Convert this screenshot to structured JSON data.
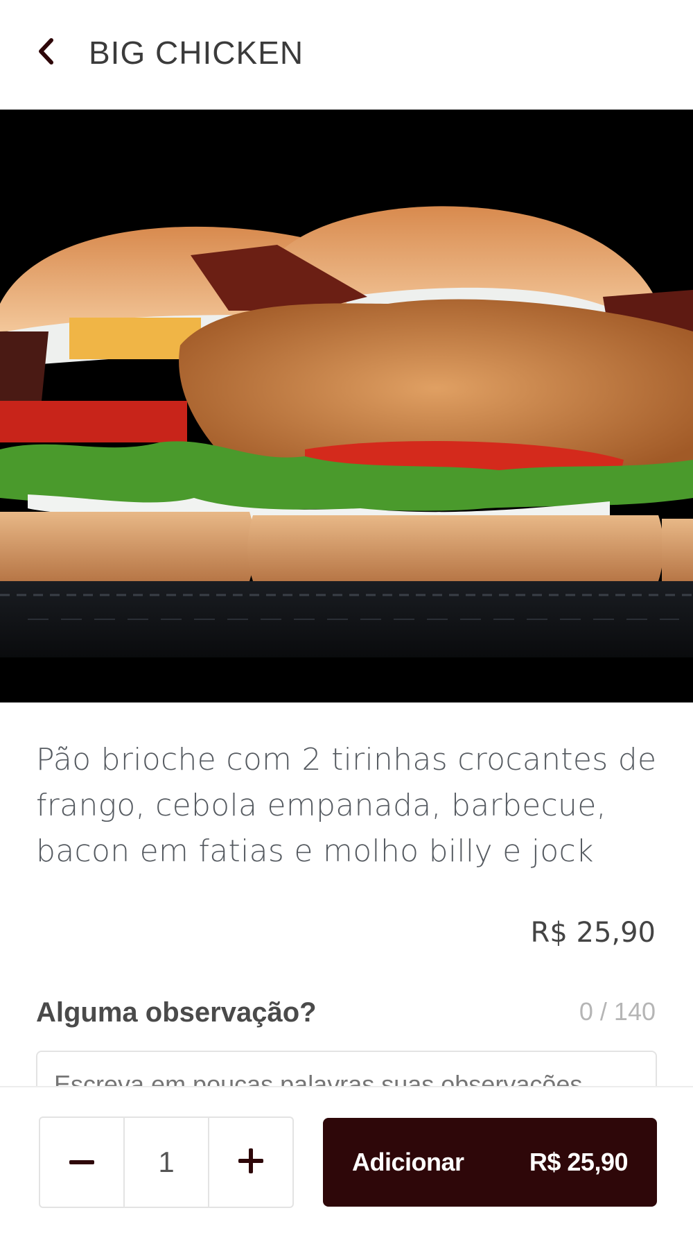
{
  "header": {
    "title": "BIG CHICKEN",
    "back_icon": "chevron-left-icon"
  },
  "product": {
    "description": "Pão brioche com 2 tirinhas crocantes de frango, cebola empanada, barbecue, bacon em fatias e molho billy e jock",
    "price": "R$ 25,90"
  },
  "notes": {
    "label": "Alguma observação?",
    "counter": "0 / 140",
    "placeholder": "Escreva em poucas palavras suas observações"
  },
  "footer": {
    "quantity": "1",
    "minus_icon": "minus-icon",
    "plus_icon": "plus-icon",
    "add_label": "Adicionar",
    "add_price": "R$ 25,90"
  },
  "colors": {
    "brand_dark": "#2e0709",
    "text_gray": "#555a60"
  }
}
